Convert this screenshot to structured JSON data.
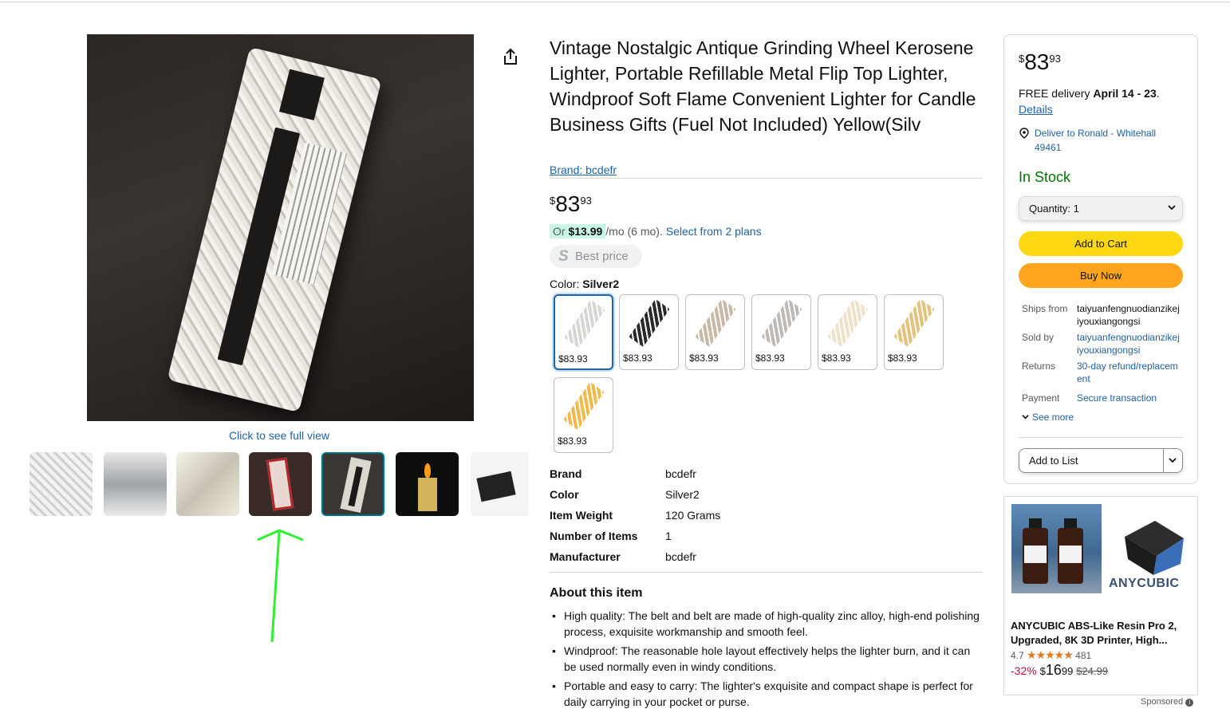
{
  "product": {
    "title": "Vintage Nostalgic Antique Grinding Wheel Kerosene Lighter, Portable Refillable Metal Flip Top Lighter, Windproof Soft Flame Convenient Lighter for Candle Business Gifts (Fuel Not Included) Yellow(Silv",
    "brand_link": "Brand: bcdefr",
    "price_symbol": "$",
    "price_whole": "83",
    "price_fraction": "93",
    "plan_prefix": "Or",
    "plan_amount": "$13.99",
    "plan_suffix": "/mo (6 mo).",
    "plan_link": "Select from 2 plans",
    "best_price_icon": "S",
    "best_price": "Best price",
    "color_label": "Color:",
    "color_selected": "Silver2",
    "full_view": "Click to see full view"
  },
  "swatches": [
    {
      "price": "$83.93",
      "color": "#d8d6d2",
      "selected": true
    },
    {
      "price": "$83.93",
      "color": "#2b2928"
    },
    {
      "price": "$83.93",
      "color": "#c9b8a4"
    },
    {
      "price": "$83.93",
      "color": "#bdbab5"
    },
    {
      "price": "$83.93",
      "color": "#efe0c6"
    },
    {
      "price": "$83.93",
      "color": "#e4c27a"
    },
    {
      "price": "$83.93",
      "color": "#f0b94a"
    }
  ],
  "specs": [
    {
      "k": "Brand",
      "v": "bcdefr"
    },
    {
      "k": "Color",
      "v": "Silver2"
    },
    {
      "k": "Item Weight",
      "v": "120 Grams"
    },
    {
      "k": "Number of Items",
      "v": "1"
    },
    {
      "k": "Manufacturer",
      "v": "bcdefr"
    }
  ],
  "about": {
    "heading": "About this item",
    "bullets": [
      "High quality: The belt and belt are made of high-quality zinc alloy, high-end polishing process, exquisite workmanship and smooth feel.",
      "Windproof: The reasonable hole layout effectively helps the lighter burn, and it can be used normally even in windy conditions.",
      "Portable and easy to carry: The lighter's exquisite and compact shape is perfect for daily carrying in your pocket or purse."
    ]
  },
  "buybox": {
    "delivery_prefix": "FREE delivery",
    "delivery_dates": "April 14 - 23",
    "delivery_suffix": ".",
    "details": "Details",
    "deliver_to": "Deliver to Ronald - Whitehall 49461",
    "stock": "In Stock",
    "quantity": "Quantity:  1",
    "add_to_cart": "Add to Cart",
    "buy_now": "Buy Now",
    "info": [
      {
        "k": "Ships from",
        "v": "taiyuanfengnuodianzikejiyouxiangongsi",
        "link": false
      },
      {
        "k": "Sold by",
        "v": "taiyuanfengnuodianzikejiyouxiangongsi",
        "link": true
      },
      {
        "k": "Returns",
        "v": "30-day refund/replacement",
        "link": true
      },
      {
        "k": "Payment",
        "v": "Secure transaction",
        "link": true
      }
    ],
    "see_more": "See more",
    "add_to_list": "Add to List"
  },
  "ad": {
    "brand": "ANYCUBIC",
    "title": "ANYCUBIC ABS-Like Resin Pro 2, Upgraded, 8K 3D Printer, High...",
    "rating": "4.7",
    "stars": "★★★★★",
    "reviews": "481",
    "discount": "-32%",
    "price_symbol": "$",
    "price_whole": "16",
    "price_fraction": "99",
    "old_price": "$24.99",
    "sponsored": "Sponsored"
  },
  "colors": {
    "link": "#2162a1",
    "in_stock": "#007600",
    "add_to_cart": "#ffd814",
    "buy_now": "#ffa41c",
    "selected_border": "#007185",
    "annotation_arrow": "#2ef02e"
  },
  "icons": [
    "share-icon",
    "location-pin-icon",
    "chevron-down-icon",
    "star-icon",
    "info-icon"
  ]
}
